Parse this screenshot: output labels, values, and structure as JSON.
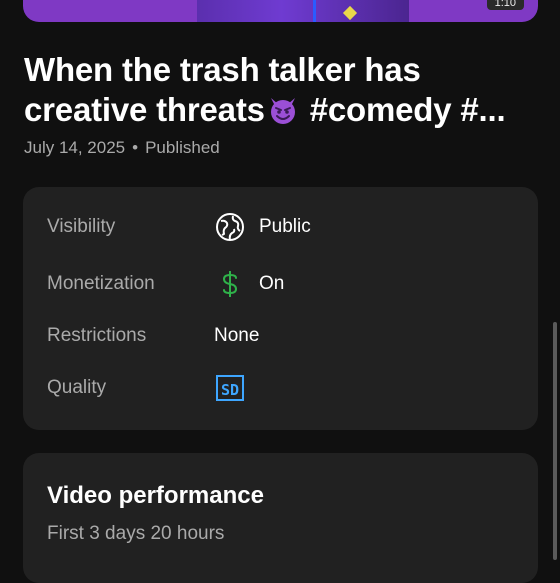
{
  "thumbnail": {
    "duration": "1:10"
  },
  "video": {
    "title_line1": "When the trash talker has",
    "title_line2_before": "creative threats",
    "title_line2_after": " #comedy #...",
    "date": "July 14, 2025",
    "separator": "•",
    "status": "Published"
  },
  "details": {
    "visibility_label": "Visibility",
    "visibility_value": "Public",
    "visibility_icon": "globe-icon",
    "monetization_label": "Monetization",
    "monetization_value": "On",
    "monetization_icon": "dollar-icon",
    "monetization_color": "#2fb24a",
    "restrictions_label": "Restrictions",
    "restrictions_value": "None",
    "quality_label": "Quality",
    "quality_badge": "SD",
    "quality_color": "#3ea6ff"
  },
  "performance": {
    "title": "Video performance",
    "subtitle": "First 3 days 20 hours"
  }
}
